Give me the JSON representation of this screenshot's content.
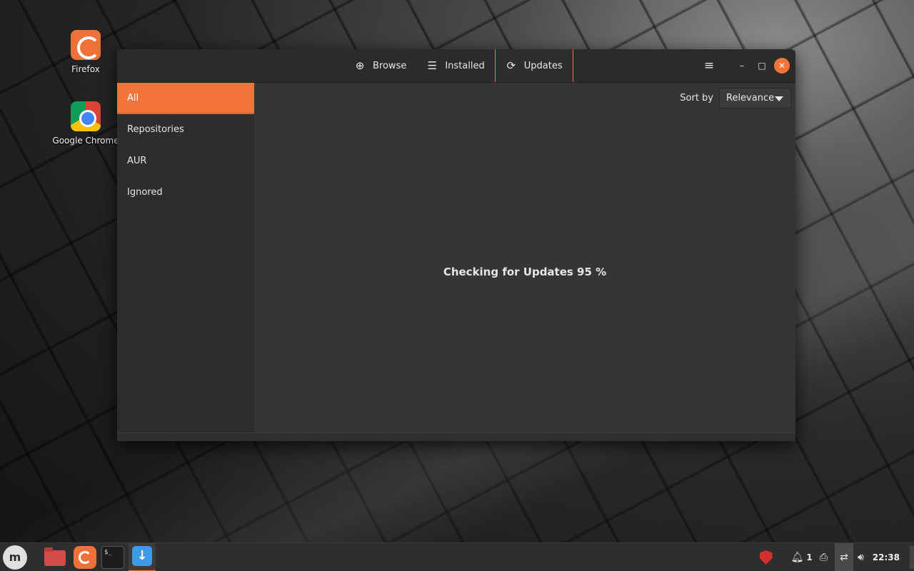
{
  "desktop": {
    "icons": [
      {
        "label": "Firefox",
        "icon": "firefox-icon"
      },
      {
        "label": "Google Chrome",
        "icon": "chrome-icon"
      }
    ]
  },
  "window": {
    "tabs": [
      {
        "label": "Browse",
        "icon": "globe-icon",
        "glyph": "⊕"
      },
      {
        "label": "Installed",
        "icon": "list-icon",
        "glyph": "☰"
      },
      {
        "label": "Updates",
        "icon": "refresh-icon",
        "glyph": "⟳",
        "active": true
      }
    ],
    "menu_glyph": "≡",
    "controls": {
      "minimize": "–",
      "maximize": "□",
      "close": "✕"
    },
    "sidebar": {
      "items": [
        {
          "label": "All",
          "active": true
        },
        {
          "label": "Repositories"
        },
        {
          "label": "AUR"
        },
        {
          "label": "Ignored"
        }
      ]
    },
    "sort": {
      "label": "Sort by",
      "value": "Relevance"
    },
    "status_message": "Checking for Updates 95 %",
    "progress_percent": 95
  },
  "taskbar": {
    "menu_glyph": "m",
    "terminal_text": "$_",
    "pamac_glyph": "↓",
    "tray": {
      "notification_count": "1",
      "clock": "22:38"
    }
  },
  "colors": {
    "accent": "#f4733b",
    "window_bg": "#353535",
    "sidebar_bg": "#2d2d2d",
    "header_bg": "#2b2b2b"
  }
}
